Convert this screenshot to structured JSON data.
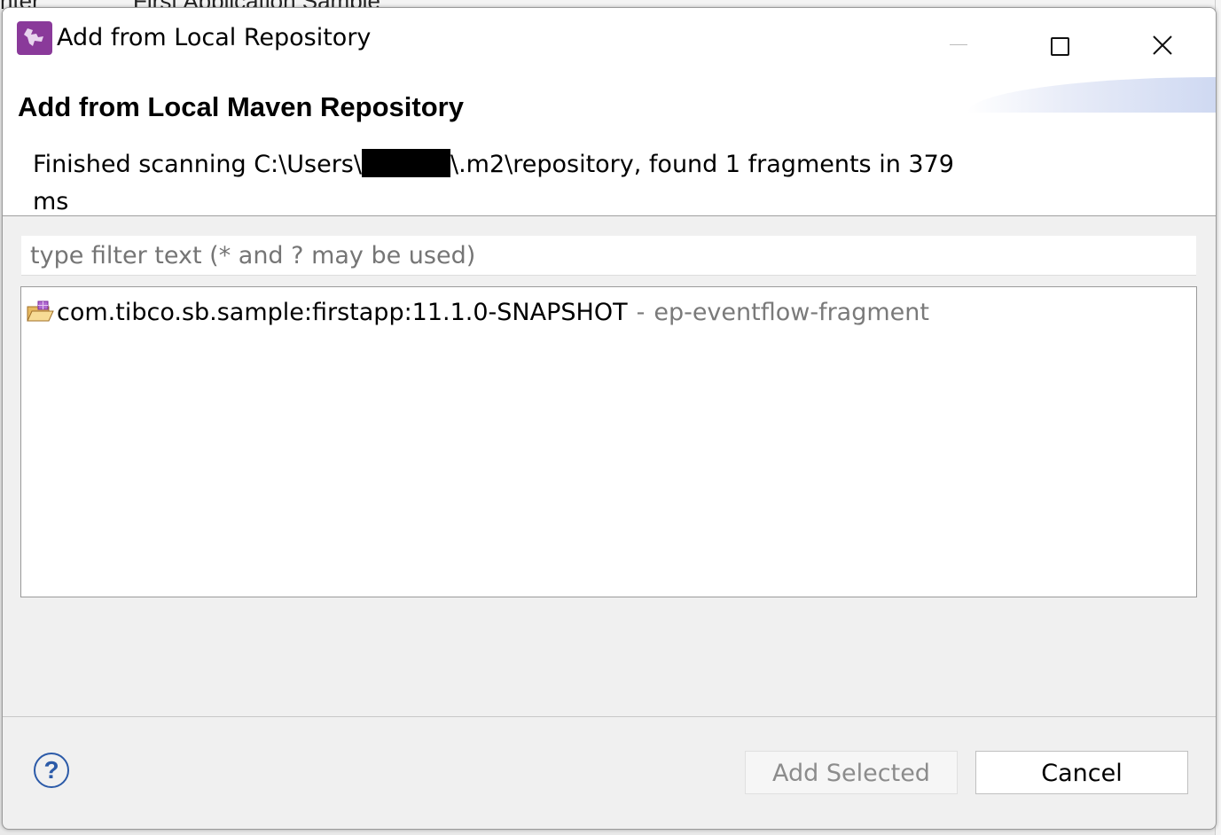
{
  "background": {
    "left_tab_text": "nter",
    "tab_text": "First Application Sample"
  },
  "window": {
    "title": "Add from Local Repository"
  },
  "header": {
    "title": "Add from Local Maven Repository",
    "message_prefix": "Finished scanning C:\\Users\\",
    "message_suffix": "\\.m2\\repository, found 1 fragments in 379 ms"
  },
  "filter": {
    "placeholder": "type filter text (* and ? may be used)"
  },
  "list": {
    "items": [
      {
        "name": "com.tibco.sb.sample:firstapp:11.1.0-SNAPSHOT",
        "separator": "-",
        "type": "ep-eventflow-fragment"
      }
    ]
  },
  "footer": {
    "help_label": "?",
    "add_selected": "Add Selected",
    "cancel": "Cancel"
  }
}
